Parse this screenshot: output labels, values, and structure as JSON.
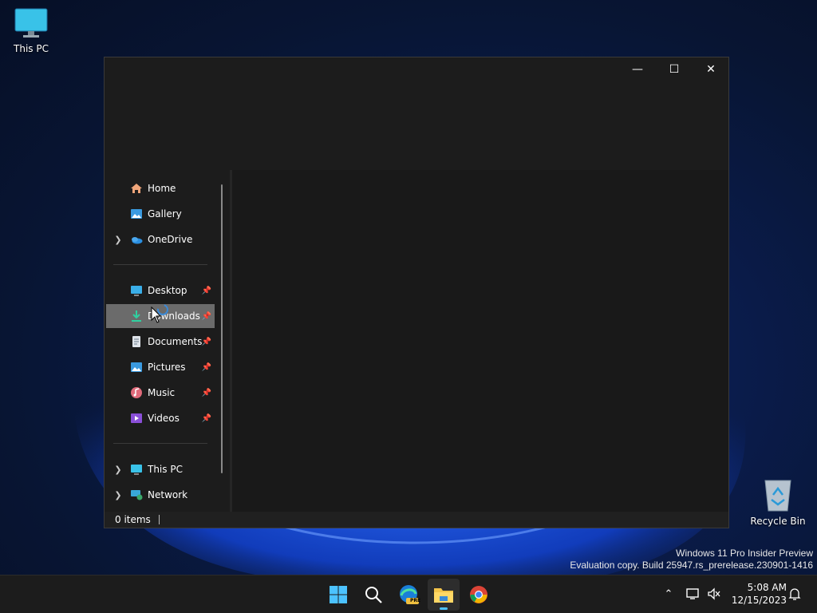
{
  "desktop": {
    "icons": [
      {
        "label": "This PC"
      },
      {
        "label": "Recycle Bin"
      }
    ],
    "watermark": {
      "line1": "Windows 11 Pro Insider Preview",
      "line2": "Evaluation copy. Build 25947.rs_prerelease.230901-1416"
    }
  },
  "window": {
    "caption": {
      "minimize": "—",
      "maximize": "☐",
      "close": "✕"
    },
    "nav": {
      "items": [
        {
          "label": "Home",
          "icon": "home-icon"
        },
        {
          "label": "Gallery",
          "icon": "gallery-icon"
        },
        {
          "label": "OneDrive",
          "icon": "onedrive-icon",
          "expandable": true
        },
        {
          "label": "Desktop",
          "icon": "desktop-folder-icon",
          "pinned": true
        },
        {
          "label": "Downloads",
          "icon": "downloads-icon",
          "pinned": true,
          "selected": true
        },
        {
          "label": "Documents",
          "icon": "documents-icon",
          "pinned": true
        },
        {
          "label": "Pictures",
          "icon": "pictures-icon",
          "pinned": true
        },
        {
          "label": "Music",
          "icon": "music-icon",
          "pinned": true
        },
        {
          "label": "Videos",
          "icon": "videos-icon",
          "pinned": true
        },
        {
          "label": "This PC",
          "icon": "this-pc-icon",
          "expandable": true
        },
        {
          "label": "Network",
          "icon": "network-icon",
          "expandable": true
        }
      ]
    },
    "status": {
      "items_count": "0 items"
    }
  },
  "taskbar": {
    "apps": [
      {
        "name": "start-button",
        "icon": "windows-logo-icon"
      },
      {
        "name": "search-button",
        "icon": "search-icon"
      },
      {
        "name": "edge-preview-button",
        "icon": "edge-pre-icon",
        "badge": "PRE"
      },
      {
        "name": "file-explorer-button",
        "icon": "folder-icon",
        "active": true
      },
      {
        "name": "chrome-button",
        "icon": "chrome-icon"
      }
    ],
    "clock": {
      "time": "5:08 AM",
      "date": "12/15/2023"
    }
  },
  "colors": {
    "accent": "#4cc2ff",
    "window_bg": "#202020",
    "selected": "#6b6b6b"
  }
}
